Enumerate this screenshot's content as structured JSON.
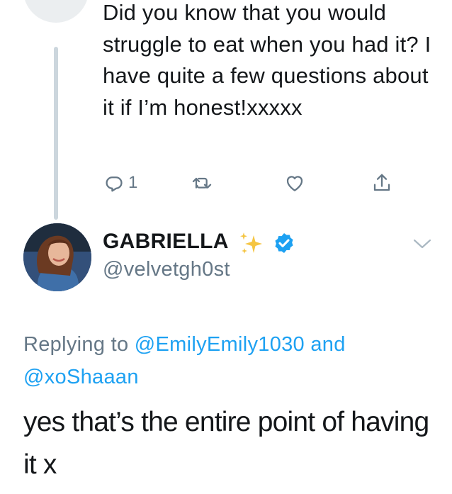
{
  "parent_tweet": {
    "text": "Did you know that you would struggle to eat when you had it? I have quite a few questions about it if I’m honest!xxxxx",
    "reply_count": "1"
  },
  "reply_tweet": {
    "display_name": "GABRIELLA",
    "name_emoji": "sparkles-icon",
    "handle": "@velvetgh0st",
    "replying_prefix": "Replying to",
    "replying_mention_1": "@EmilyEmily1030",
    "replying_and": "and",
    "replying_mention_2": "@xoShaaan",
    "text": "yes that’s the entire point of having it x"
  },
  "colors": {
    "text": "#14171a",
    "secondary": "#657786",
    "link": "#1da1f2",
    "verified": "#1da1f2",
    "thread_line": "#ccd6dd"
  },
  "icons": [
    "reply-icon",
    "retweet-icon",
    "like-icon",
    "share-icon",
    "verified-badge-icon",
    "chevron-down-icon"
  ]
}
